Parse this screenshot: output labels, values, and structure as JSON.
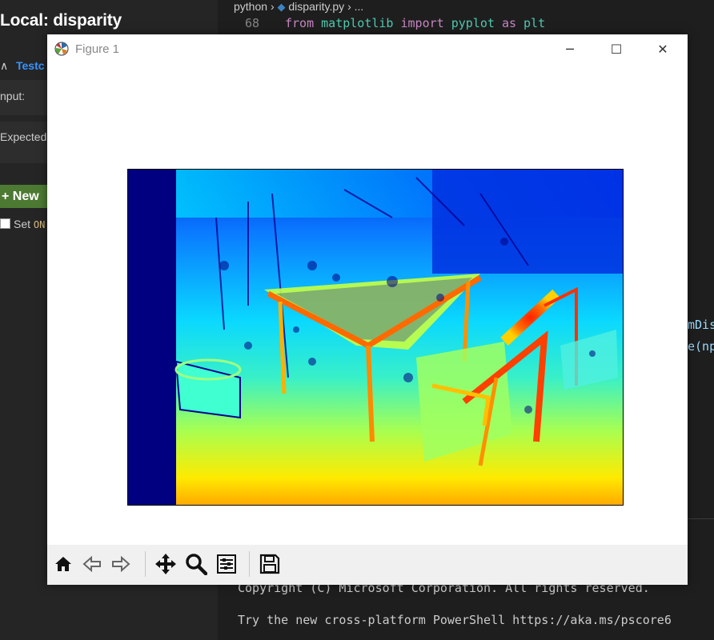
{
  "left_panel": {
    "title": "Local: disparity",
    "testcase_label": "Testc",
    "input_label": "nput:",
    "expected_label": "Expected",
    "new_button": "New",
    "set_label": "Set",
    "set_keyword": "ON"
  },
  "editor": {
    "breadcrumb": {
      "folder": "python",
      "file": "disparity.py",
      "rest": "..."
    },
    "code_line": {
      "number": "68",
      "tokens": [
        "from",
        "matplotlib",
        "import",
        "pyplot",
        "as",
        "plt"
      ]
    },
    "right_fragments": [
      "mDis",
      "e(np"
    ],
    "terminal": {
      "line1": "Copyright (C) Microsoft Corporation. All rights reserved.",
      "line2": "Try the new cross-platform PowerShell https://aka.ms/pscore6"
    }
  },
  "figure_window": {
    "title": "Figure 1",
    "window_buttons": {
      "minimize": "─",
      "maximize": "☐",
      "close": "✕"
    },
    "image": {
      "colormap": "jet",
      "description_icon": "disparity-map"
    },
    "toolbar": [
      "home-icon",
      "back-icon",
      "forward-icon",
      "pan-icon",
      "zoom-icon",
      "configure-subplots-icon",
      "save-icon"
    ]
  }
}
